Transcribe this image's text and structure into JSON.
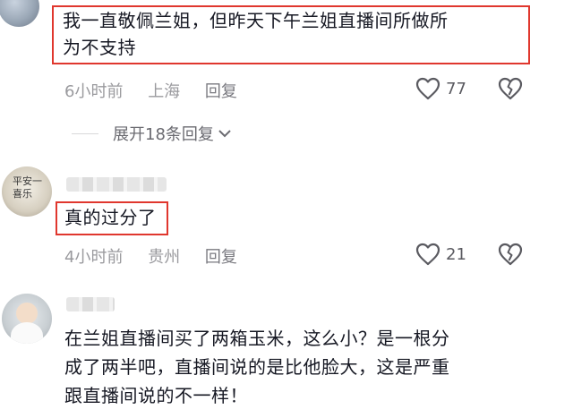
{
  "comments": [
    {
      "text_line1": "我一直敬佩兰姐，但昨天下午兰姐直播间所做所",
      "text_line2": "为不支持",
      "time": "6小时前",
      "location": "上海",
      "reply_label": "回复",
      "likes": "77",
      "expand_label": "展开18条回复"
    },
    {
      "text_line1": "真的过分了",
      "time": "4小时前",
      "location": "贵州",
      "reply_label": "回复",
      "likes": "21"
    },
    {
      "text_line1": "在兰姐直播间买了两箱玉米，这么小？是一根分",
      "text_line2": "成了两半吧，直播间说的是比他脸大，这是严重",
      "text_line3": "跟直播间说的不一样！"
    }
  ],
  "avatar2_text": "平安一喜乐",
  "colors": {
    "highlight": "#e0372e",
    "meta": "#9a9a9e",
    "text": "#161823"
  },
  "icons": [
    "heart-icon",
    "broken-heart-icon",
    "chevron-down-icon"
  ]
}
